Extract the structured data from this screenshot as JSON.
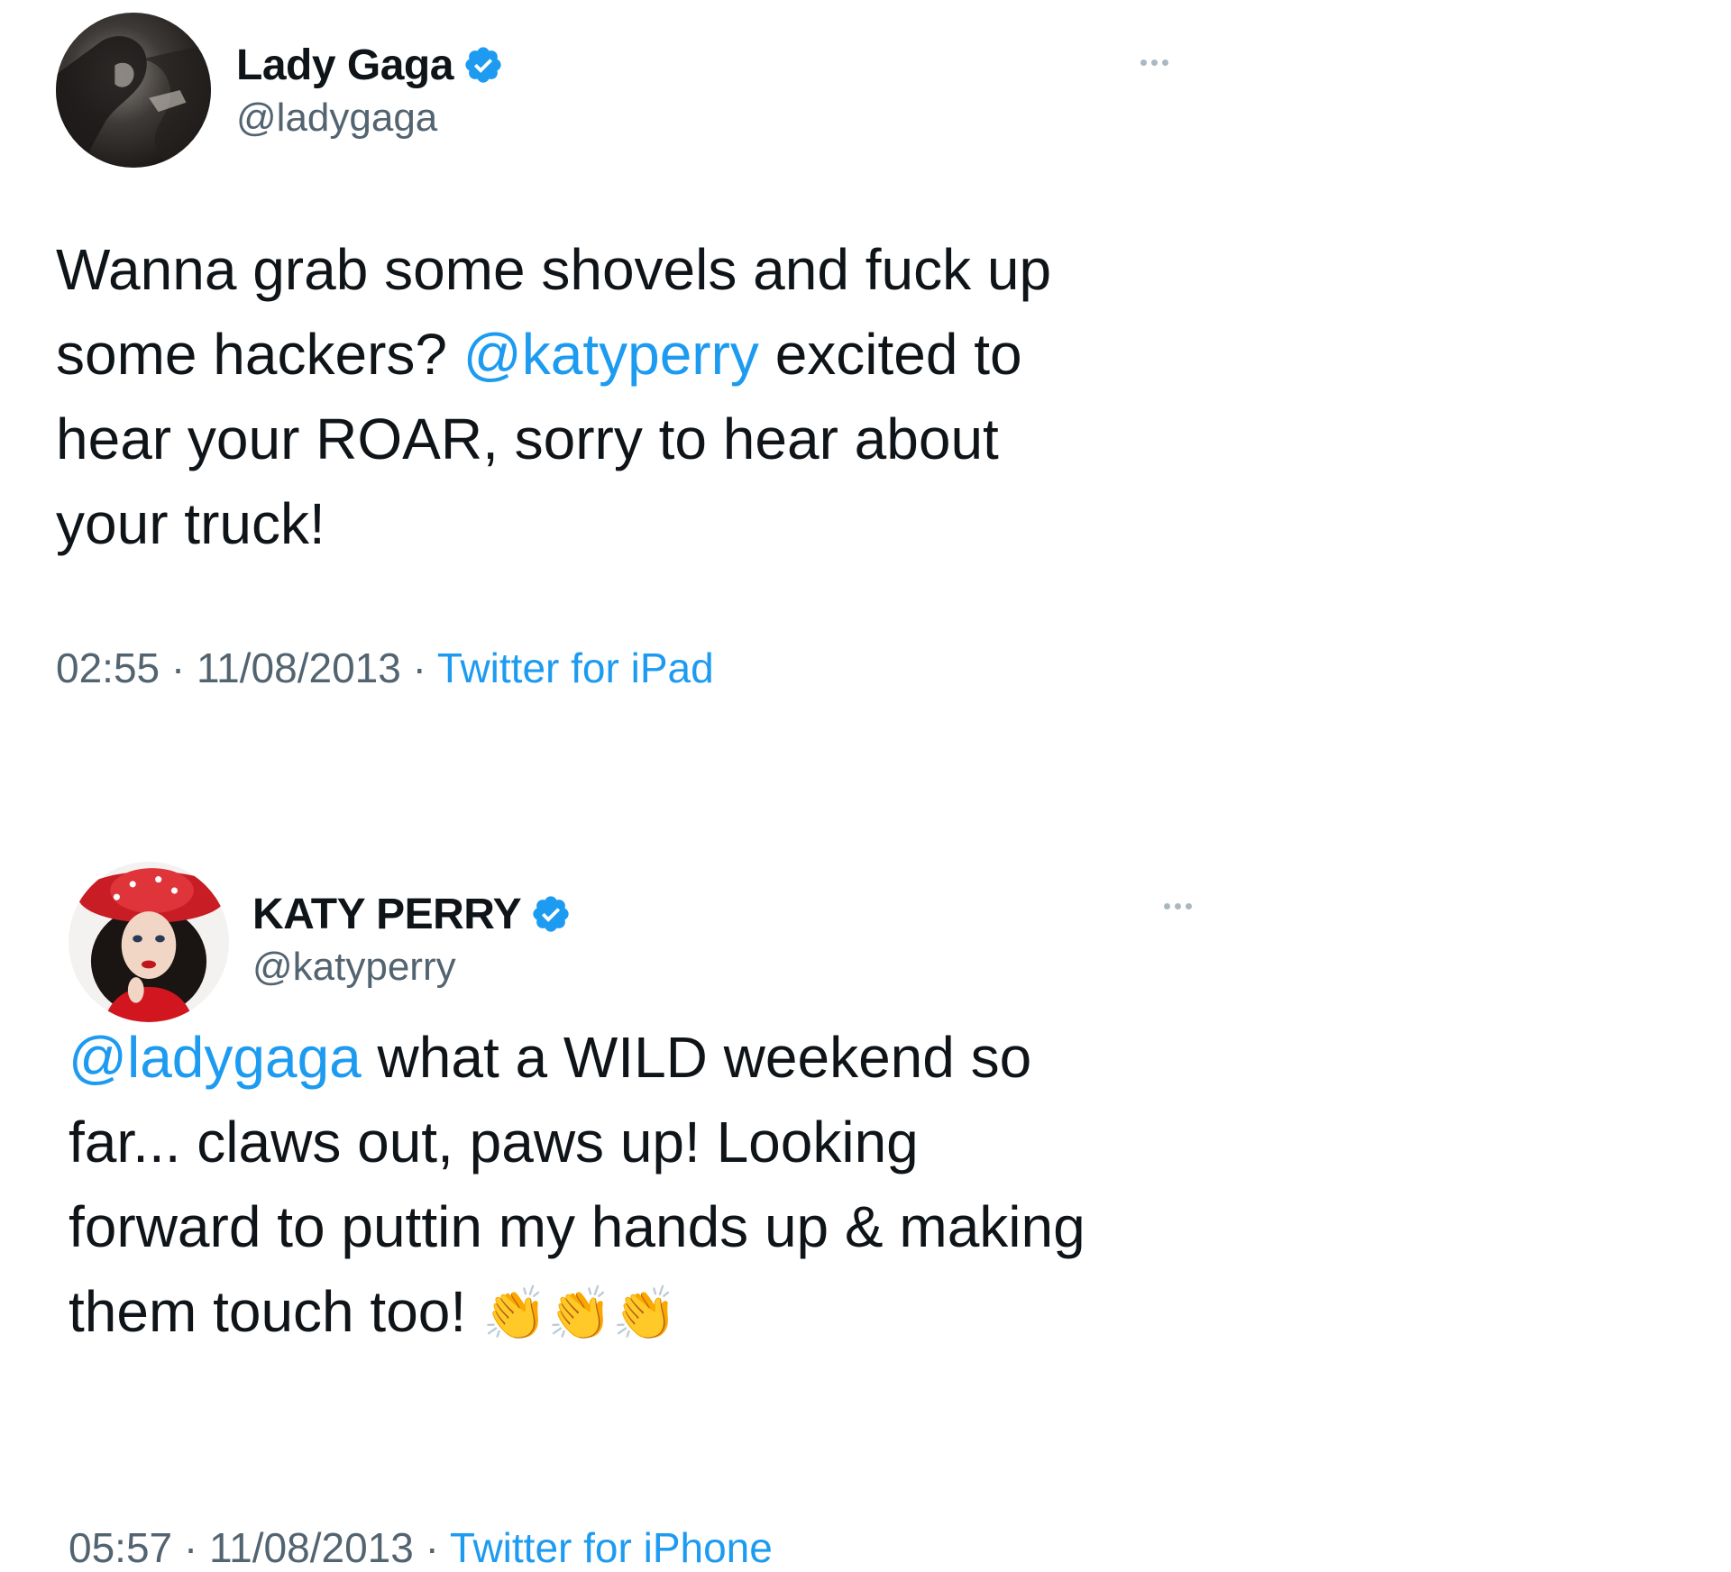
{
  "tweets": [
    {
      "display_name": "Lady Gaga",
      "handle": "@ladygaga",
      "verified_icon": "verified-badge-icon",
      "more_icon": "more-options-icon",
      "text_parts": {
        "line1": "Wanna grab some shovels and fuck up",
        "line2_pre": "some hackers? ",
        "mention": "@katyperry",
        "line2_post": " excited to",
        "line3": "hear your ROAR, sorry to hear about",
        "line4": "your truck!"
      },
      "time": "02:55",
      "sep1": " · ",
      "date": "11/08/2013",
      "sep2": " · ",
      "source": "Twitter for iPad"
    },
    {
      "display_name": "KATY PERRY",
      "handle": "@katyperry",
      "verified_icon": "verified-badge-icon",
      "more_icon": "more-options-icon",
      "text_parts": {
        "mention": "@ladygaga",
        "line1_post": " what a WILD weekend so",
        "line2": "far... claws out, paws up! Looking",
        "line3": "forward to puttin my hands up & making",
        "line4": "them touch too! ",
        "emoji": "👏👏👏"
      },
      "time": "05:57",
      "sep1": " · ",
      "date": "11/08/2013",
      "sep2": " · ",
      "source": "Twitter for iPhone"
    }
  ],
  "colors": {
    "link_blue": "#1d9bf0",
    "text_primary": "#0f1419",
    "text_secondary": "#536471",
    "verified_blue": "#1d9bf0"
  }
}
